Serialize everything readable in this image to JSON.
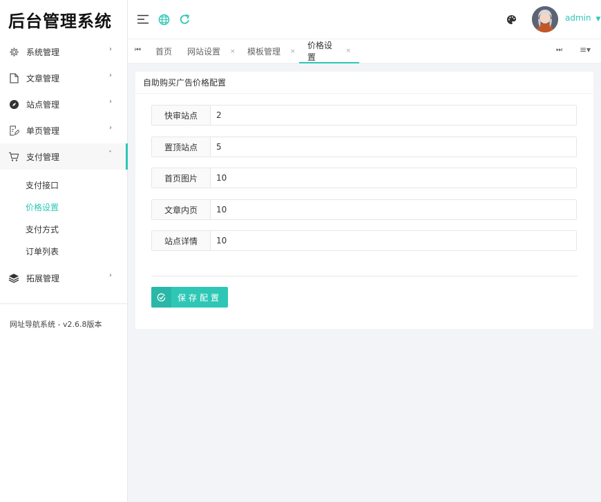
{
  "app": {
    "title": "后台管理系统",
    "version": "网址导航系统 - v2.6.8版本"
  },
  "header": {
    "username": "admin"
  },
  "sidebar": {
    "items": [
      {
        "label": "系统管理",
        "icon": "gear-icon"
      },
      {
        "label": "文章管理",
        "icon": "document-icon"
      },
      {
        "label": "站点管理",
        "icon": "compass-icon"
      },
      {
        "label": "单页管理",
        "icon": "page-edit-icon"
      },
      {
        "label": "支付管理",
        "icon": "cart-icon"
      },
      {
        "label": "拓展管理",
        "icon": "layers-icon"
      }
    ],
    "payment_sub": [
      {
        "label": "支付接口"
      },
      {
        "label": "价格设置"
      },
      {
        "label": "支付方式"
      },
      {
        "label": "订单列表"
      }
    ],
    "active_sub": "价格设置"
  },
  "tabs": [
    {
      "label": "首页"
    },
    {
      "label": "网站设置",
      "close": "×"
    },
    {
      "label": "模板管理",
      "close": "×"
    },
    {
      "label": "价格设置",
      "close": "×"
    }
  ],
  "card": {
    "title": "自助购买广告价格配置",
    "fields": [
      {
        "label": "快审站点",
        "value": "2"
      },
      {
        "label": "置顶站点",
        "value": "5"
      },
      {
        "label": "首页图片",
        "value": "10"
      },
      {
        "label": "文章内页",
        "value": "10"
      },
      {
        "label": "站点详情",
        "value": "10"
      }
    ],
    "save_label": "保存配置"
  },
  "colors": {
    "accent": "#2ec7b6"
  }
}
